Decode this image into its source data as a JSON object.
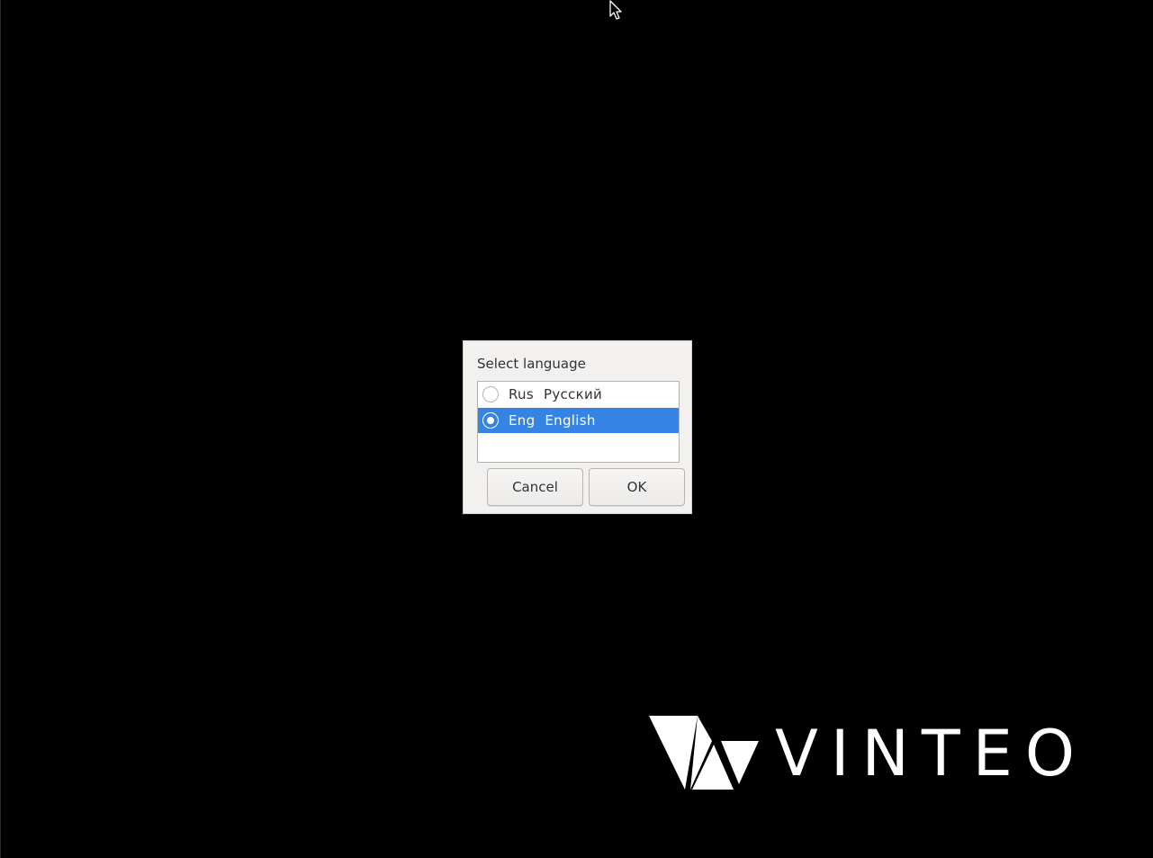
{
  "dialog": {
    "title": "Select language",
    "options": [
      {
        "code": "Rus",
        "name": "Русский",
        "selected": false
      },
      {
        "code": "Eng",
        "name": "English",
        "selected": true
      }
    ],
    "cancel_label": "Cancel",
    "ok_label": "OK"
  },
  "branding": {
    "logo_text": "VINTEO",
    "logo_icon": "vinteo-logo-icon"
  },
  "colors": {
    "background": "#000000",
    "dialog_bg": "#f2f1f0",
    "selection": "#3584e4",
    "logo": "#ffffff"
  },
  "icons": {
    "pointer": "mouse-cursor-icon",
    "radio_off": "radio-unchecked-icon",
    "radio_on": "radio-checked-icon"
  }
}
